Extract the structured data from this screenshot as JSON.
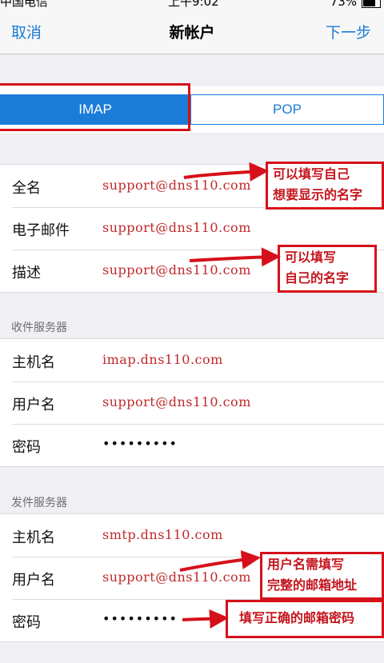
{
  "status_bar": {
    "carrier": "中国电信",
    "time": "上午9:02",
    "battery": "73%"
  },
  "nav": {
    "cancel": "取消",
    "title": "新帐户",
    "next": "下一步"
  },
  "segments": {
    "imap": "IMAP",
    "pop": "POP",
    "selected": "IMAP"
  },
  "account": {
    "name_label": "全名",
    "name_value": "support@dns110.com",
    "email_label": "电子邮件",
    "email_value": "support@dns110.com",
    "desc_label": "描述",
    "desc_value": "support@dns110.com"
  },
  "incoming": {
    "header": "收件服务器",
    "host_label": "主机名",
    "host_value": "imap.dns110.com",
    "user_label": "用户名",
    "user_value": "support@dns110.com",
    "password_label": "密码",
    "password_value": "•••••••••"
  },
  "outgoing": {
    "header": "发件服务器",
    "host_label": "主机名",
    "host_value": "smtp.dns110.com",
    "user_label": "用户名",
    "user_value": "support@dns110.com",
    "password_label": "密码",
    "password_value": "•••••••••"
  },
  "annotations": {
    "note1_line1": "可以填写自己",
    "note1_line2": "想要显示的名字",
    "note2_line1": "可以填写",
    "note2_line2": "自己的名字",
    "note3_line1": "用户名需填写",
    "note3_line2": "完整的邮箱地址",
    "note4": "填写正确的邮箱密码"
  },
  "colors": {
    "accent": "#1a7cd7",
    "annotation_red": "#d6101a",
    "value_red": "#c0282a",
    "background": "#efeff4"
  }
}
